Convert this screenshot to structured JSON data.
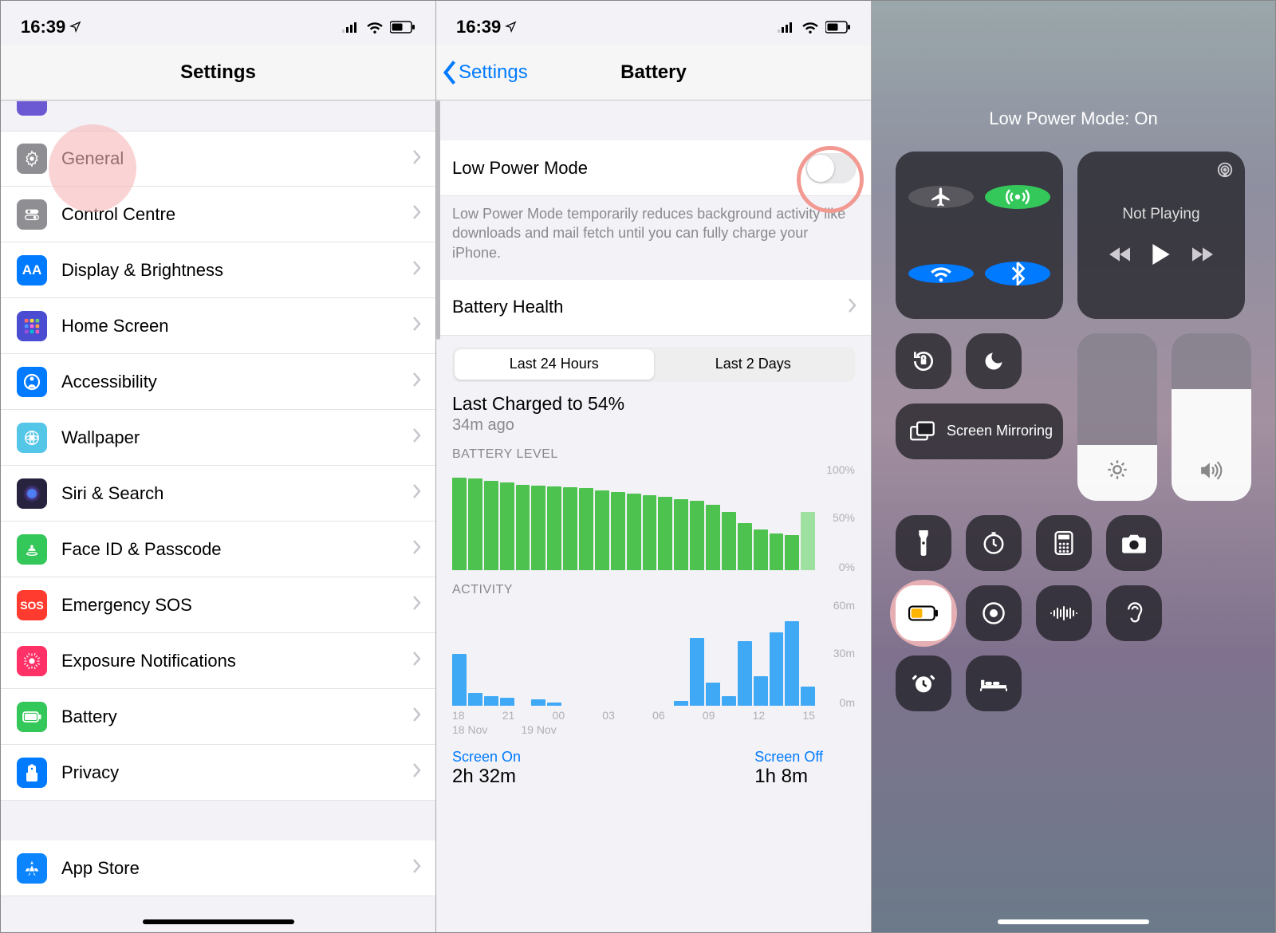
{
  "status": {
    "time": "16:39"
  },
  "pane1": {
    "title": "Settings",
    "items": [
      {
        "label": "General",
        "color": "#8e8e93",
        "hl": true
      },
      {
        "label": "Control Centre",
        "color": "#8e8e93"
      },
      {
        "label": "Display & Brightness",
        "color": "#007aff"
      },
      {
        "label": "Home Screen",
        "color": "#4a4cd2"
      },
      {
        "label": "Accessibility",
        "color": "#007aff"
      },
      {
        "label": "Wallpaper",
        "color": "#54c6e8"
      },
      {
        "label": "Siri & Search",
        "color": "#27233f"
      },
      {
        "label": "Face ID & Passcode",
        "color": "#34c759"
      },
      {
        "label": "Emergency SOS",
        "color": "#ff3b30"
      },
      {
        "label": "Exposure Notifications",
        "color": "#ff3167"
      },
      {
        "label": "Battery",
        "color": "#34c759"
      },
      {
        "label": "Privacy",
        "color": "#007aff"
      }
    ],
    "appstore": "App Store"
  },
  "pane2": {
    "back": "Settings",
    "title": "Battery",
    "lowpower": "Low Power Mode",
    "desc": "Low Power Mode temporarily reduces background activity like downloads and mail fetch until you can fully charge your iPhone.",
    "health": "Battery Health",
    "seg": [
      "Last 24 Hours",
      "Last 2 Days"
    ],
    "charged_t": "Last Charged to 54%",
    "charged_s": "34m ago",
    "blevel": "BATTERY LEVEL",
    "activity": "ACTIVITY",
    "ylabels_b": [
      "100%",
      "50%",
      "0%"
    ],
    "ylabels_a": [
      "60m",
      "30m",
      "0m"
    ],
    "xticks": [
      "18",
      "21",
      "00",
      "03",
      "06",
      "09",
      "12",
      "15"
    ],
    "xdates": [
      "18 Nov",
      "19 Nov"
    ],
    "screen_on_t": "Screen On",
    "screen_on_v": "2h 32m",
    "screen_off_t": "Screen Off",
    "screen_off_v": "1h 8m"
  },
  "pane3": {
    "title": "Low Power Mode: On",
    "notplaying": "Not Playing",
    "mirror": "Screen Mirroring"
  },
  "chart_data": [
    {
      "type": "bar",
      "title": "BATTERY LEVEL",
      "ylabel": "%",
      "ylim": [
        0,
        100
      ],
      "x": [
        "18",
        "19",
        "20",
        "21",
        "22",
        "23",
        "00",
        "01",
        "02",
        "03",
        "04",
        "05",
        "06",
        "07",
        "08",
        "09",
        "10",
        "11",
        "12",
        "13",
        "14",
        "15",
        "16"
      ],
      "values": [
        95,
        94,
        92,
        90,
        88,
        87,
        86,
        85,
        84,
        82,
        80,
        79,
        77,
        75,
        73,
        71,
        67,
        60,
        48,
        42,
        38,
        36,
        60
      ]
    },
    {
      "type": "bar",
      "title": "ACTIVITY",
      "ylabel": "minutes",
      "ylim": [
        0,
        60
      ],
      "x": [
        "18",
        "19",
        "20",
        "21",
        "22",
        "23",
        "00",
        "01",
        "02",
        "03",
        "04",
        "05",
        "06",
        "07",
        "08",
        "09",
        "10",
        "11",
        "12",
        "13",
        "14",
        "15",
        "16"
      ],
      "values": [
        32,
        8,
        6,
        5,
        0,
        4,
        2,
        0,
        0,
        0,
        0,
        0,
        0,
        0,
        3,
        42,
        14,
        6,
        40,
        18,
        45,
        52,
        12
      ]
    }
  ]
}
